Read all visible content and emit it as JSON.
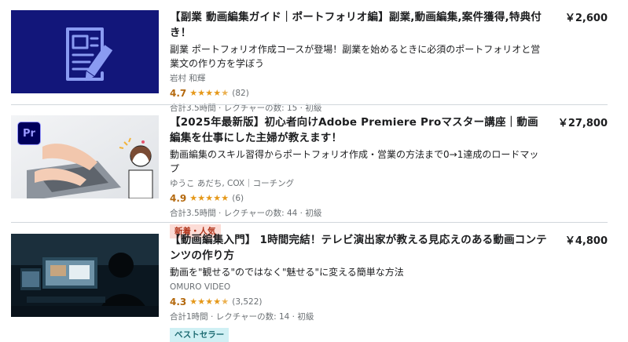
{
  "courses": [
    {
      "title": "【副業 動画編集ガイド｜ポートフォリオ編】副業,動画編集,案件獲得,特典付き！",
      "headline": "副業 ポートフォリオ作成コースが登場！副業を始めるときに必須のポートフォリオと営業文の作り方を学ぼう",
      "instructor": "岩村 和輝",
      "rating": "4.7",
      "rating_value": 4.7,
      "rating_count": "(82)",
      "meta": "合計3.5時間 · レクチャーの数: 15 · 初級",
      "price": "￥2,600",
      "badge": ""
    },
    {
      "title": "【2025年最新版】初心者向けAdobe Premiere Proマスター講座｜動画編集を仕事にした主婦が教えます！",
      "headline": "動画編集のスキル習得からポートフォリオ作成・営業の方法まで0→1達成のロードマップ",
      "instructor": "ゆうこ あだち, COX｜コーチング",
      "rating": "4.9",
      "rating_value": 4.9,
      "rating_count": "(6)",
      "meta": "合計3.5時間 · レクチャーの数: 44 · 初級",
      "price": "￥27,800",
      "badge": "新着・人気",
      "thumb_logo": "Pr"
    },
    {
      "title": "【動画編集入門】 1時間完結！テレビ演出家が教える見応えのある動画コンテンツの作り方",
      "headline": "動画を\"観せる\"のではなく\"魅せる\"に変える簡単な方法",
      "instructor": "OMURO VIDEO",
      "rating": "4.3",
      "rating_value": 4.3,
      "rating_count": "(3,522)",
      "meta": "合計1時間 · レクチャーの数: 14 · 初級",
      "price": "￥4,800",
      "badge": "ベストセラー"
    }
  ],
  "colors": {
    "rating": "#b4690e",
    "star": "#e59819",
    "badge_new_bg": "#fcdcd6",
    "badge_best_bg": "#d0f0f4",
    "thumb1_bg": "#12167a",
    "thumb1_icon": "#8a9bf2"
  }
}
